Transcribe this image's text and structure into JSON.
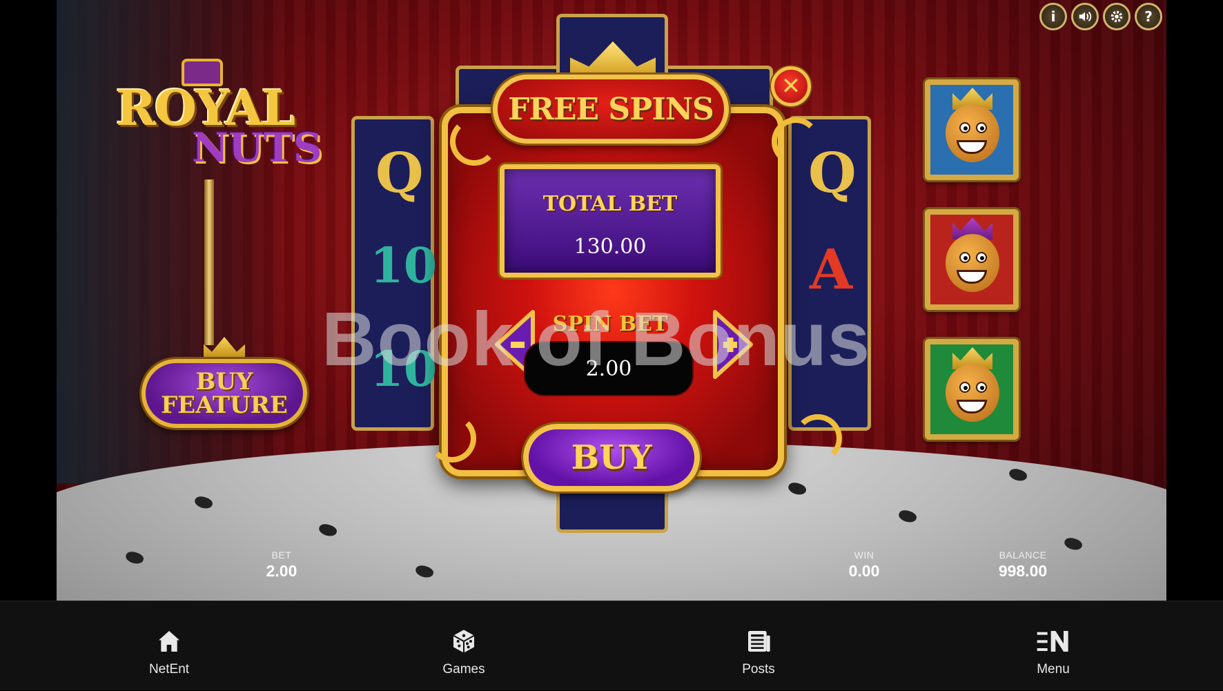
{
  "game": {
    "logo_line1": "ROYAL",
    "logo_line2": "NUTS",
    "buy_feature_label": "BUY FEATURE",
    "watermark": "Book of Bonus"
  },
  "top_controls": [
    {
      "name": "info-icon",
      "glyph": "i"
    },
    {
      "name": "sound-icon",
      "glyph": ""
    },
    {
      "name": "settings-icon",
      "glyph": ""
    },
    {
      "name": "help-icon",
      "glyph": "?"
    }
  ],
  "dialog": {
    "title": "FREE SPINS",
    "close_glyph": "✕",
    "total_bet_label": "TOTAL BET",
    "total_bet_value": "130.00",
    "spin_bet_label": "SPIN BET",
    "spin_bet_value": "2.00",
    "minus_glyph": "−",
    "plus_glyph": "+",
    "buy_label": "BUY"
  },
  "stats": {
    "bet_label": "BET",
    "bet_value": "2.00",
    "win_label": "WIN",
    "win_value": "0.00",
    "balance_label": "BALANCE",
    "balance_value": "998.00"
  },
  "nav": [
    {
      "label": "NetEnt",
      "icon": "home-icon"
    },
    {
      "label": "Games",
      "icon": "dice-icon"
    },
    {
      "label": "Posts",
      "icon": "newspaper-icon"
    },
    {
      "label": "Menu",
      "icon": "menu-icon"
    }
  ],
  "colors": {
    "gold": "#f3c24a",
    "purple": "#6312a8",
    "red": "#d0120f",
    "nav_bg": "#111112"
  }
}
